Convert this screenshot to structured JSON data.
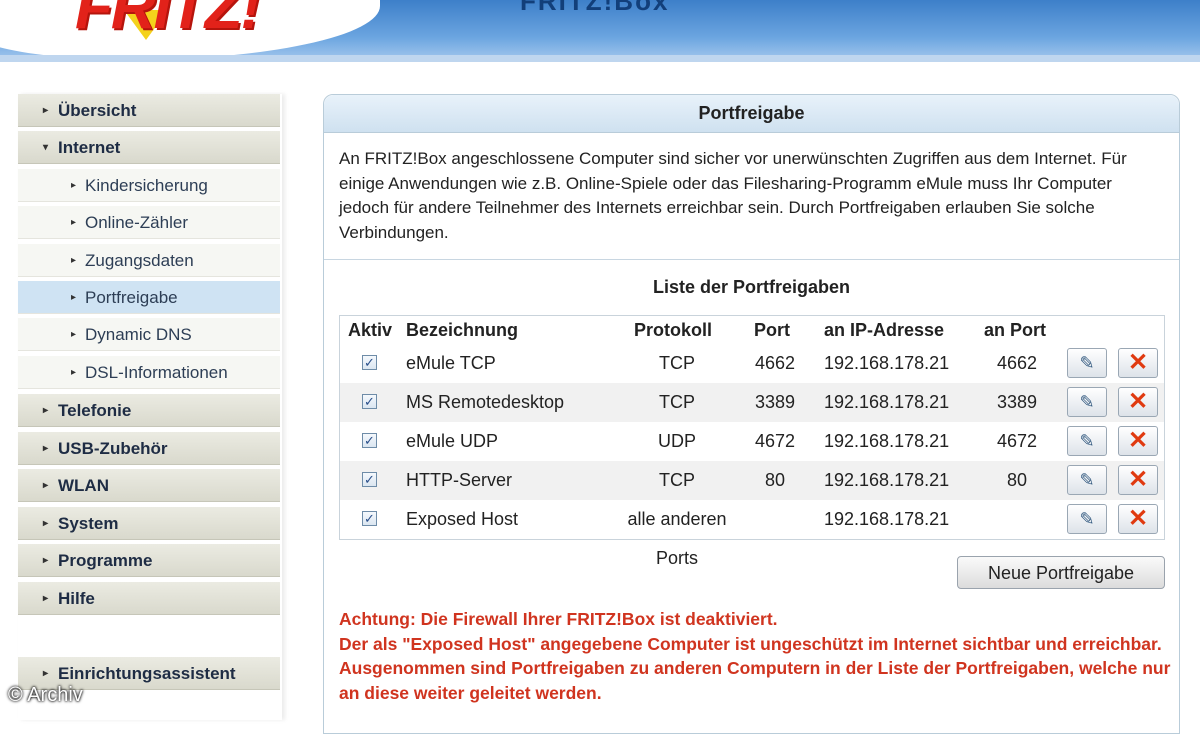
{
  "header": {
    "logo_text": "FRITZ!",
    "title": "FRITZ!Box"
  },
  "sidebar": {
    "items": [
      {
        "label": "Übersicht",
        "arrow": "▸",
        "level": 1
      },
      {
        "label": "Internet",
        "arrow": "▾",
        "level": 1
      },
      {
        "label": "Kindersicherung",
        "arrow": "▸",
        "level": 2
      },
      {
        "label": "Online-Zähler",
        "arrow": "▸",
        "level": 2
      },
      {
        "label": "Zugangsdaten",
        "arrow": "▸",
        "level": 2
      },
      {
        "label": "Portfreigabe",
        "arrow": "▸",
        "level": 2,
        "active": true
      },
      {
        "label": "Dynamic DNS",
        "arrow": "▸",
        "level": 2
      },
      {
        "label": "DSL-Informationen",
        "arrow": "▸",
        "level": 2
      },
      {
        "label": "Telefonie",
        "arrow": "▸",
        "level": 1
      },
      {
        "label": "USB-Zubehör",
        "arrow": "▸",
        "level": 1
      },
      {
        "label": "WLAN",
        "arrow": "▸",
        "level": 1
      },
      {
        "label": "System",
        "arrow": "▸",
        "level": 1
      },
      {
        "label": "Programme",
        "arrow": "▸",
        "level": 1
      },
      {
        "label": "Hilfe",
        "arrow": "▸",
        "level": 1
      },
      {
        "label": "Einrichtungsassistent",
        "arrow": "▸",
        "level": 1
      }
    ]
  },
  "panel": {
    "title": "Portfreigabe",
    "intro": "An FRITZ!Box angeschlossene Computer sind sicher vor unerwünschten Zugriffen aus dem Internet. Für einige Anwendungen wie z.B. Online-Spiele oder das Filesharing-Programm eMule muss Ihr Computer jedoch für andere Teilnehmer des Internets erreichbar sein. Durch Portfreigaben erlauben Sie solche Verbindungen.",
    "list_title": "Liste der Portfreigaben",
    "columns": {
      "aktiv": "Aktiv",
      "bezeichnung": "Bezeichnung",
      "protokoll": "Protokoll",
      "port": "Port",
      "ip": "an IP-Adresse",
      "an_port": "an Port"
    },
    "rows": [
      {
        "aktiv": true,
        "bezeichnung": "eMule TCP",
        "protokoll": "TCP",
        "port": "4662",
        "ip": "192.168.178.21",
        "an_port": "4662"
      },
      {
        "aktiv": true,
        "bezeichnung": "MS Remotedesktop",
        "protokoll": "TCP",
        "port": "3389",
        "ip": "192.168.178.21",
        "an_port": "3389"
      },
      {
        "aktiv": true,
        "bezeichnung": "eMule UDP",
        "protokoll": "UDP",
        "port": "4672",
        "ip": "192.168.178.21",
        "an_port": "4672"
      },
      {
        "aktiv": true,
        "bezeichnung": "HTTP-Server",
        "protokoll": "TCP",
        "port": "80",
        "ip": "192.168.178.21",
        "an_port": "80"
      },
      {
        "aktiv": true,
        "bezeichnung": "Exposed Host",
        "protokoll": "alle anderen Ports",
        "port": "",
        "ip": "192.168.178.21",
        "an_port": ""
      }
    ],
    "new_button": "Neue Portfreigabe",
    "warning_line1": "Achtung: Die Firewall Ihrer FRITZ!Box ist deaktiviert.",
    "warning_line2": "Der als \"Exposed Host\" angegebene Computer ist ungeschützt im Internet sichtbar und erreichbar. Ausgenommen sind Portfreigaben zu anderen Computern in der Liste der Portfreigaben, welche nur an diese weiter geleitet werden."
  },
  "icons": {
    "edit": "edit-icon",
    "delete": "delete-icon",
    "checkbox_mark": "✓"
  },
  "colors": {
    "warning": "#d0341f",
    "active_nav": "#cfe3f3",
    "header_blue": "#3d7fc9"
  },
  "watermark": "© Archiv"
}
